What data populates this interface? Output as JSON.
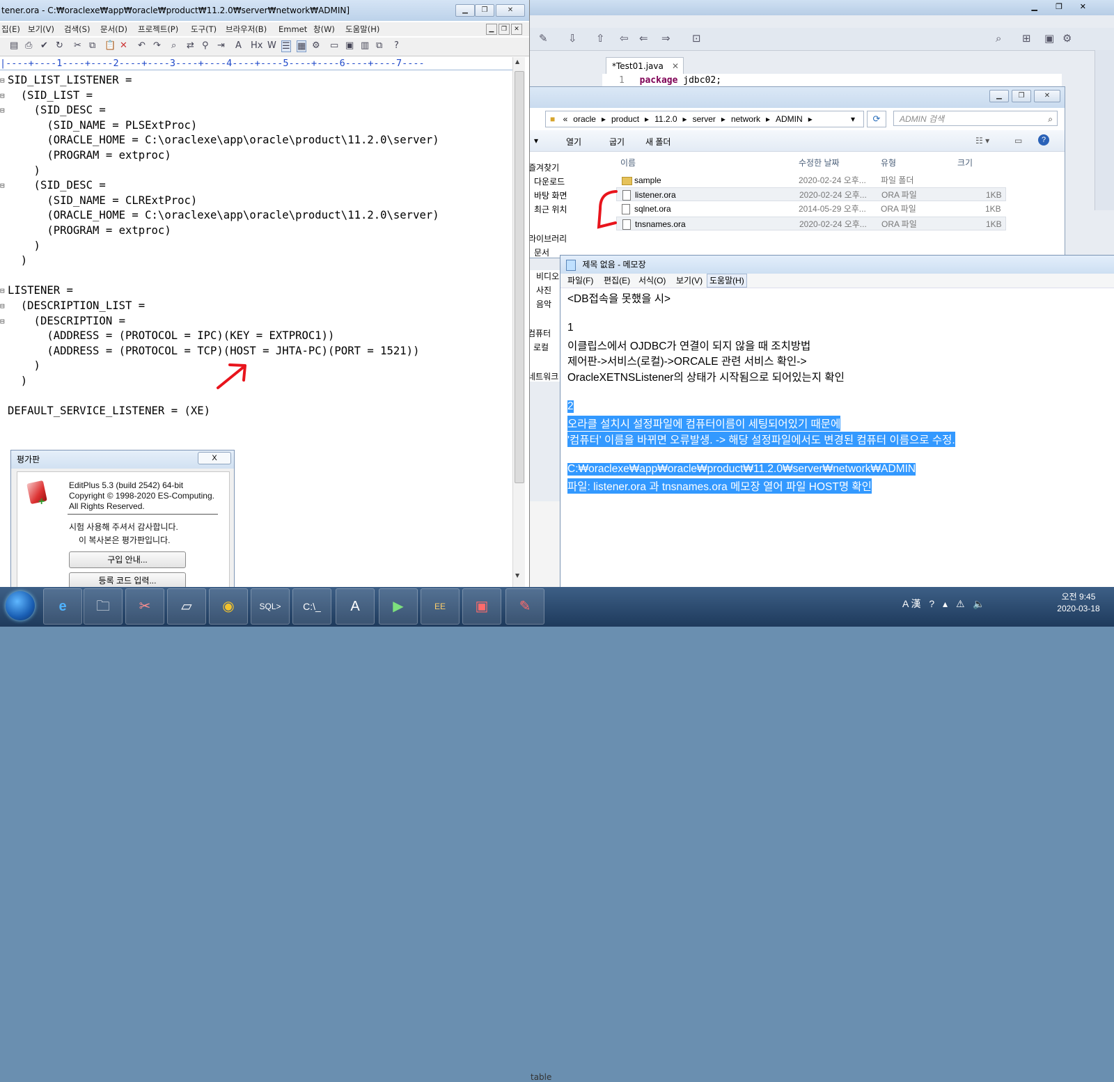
{
  "editplus": {
    "title": "tener.ora - C:₩oraclexe₩app₩oracle₩product₩11.2.0₩server₩network₩ADMIN]",
    "menu": [
      "집(E)",
      "보기(V)",
      "검색(S)",
      "문서(D)",
      "프로젝트(P)",
      "도구(T)",
      "브라우저(B)",
      "Emmet",
      "창(W)",
      "도움말(H)"
    ],
    "ruler": "|----+----1----+----2----+----3----+----4----+----5----+----6----+----7----",
    "code_lines": [
      "SID_LIST_LISTENER =",
      "  (SID_LIST =",
      "    (SID_DESC =",
      "      (SID_NAME = PLSExtProc)",
      "      (ORACLE_HOME = C:\\oraclexe\\app\\oracle\\product\\11.2.0\\server)",
      "      (PROGRAM = extproc)",
      "    )",
      "    (SID_DESC =",
      "      (SID_NAME = CLRExtProc)",
      "      (ORACLE_HOME = C:\\oraclexe\\app\\oracle\\product\\11.2.0\\server)",
      "      (PROGRAM = extproc)",
      "    )",
      "  )",
      "",
      "LISTENER =",
      "  (DESCRIPTION_LIST =",
      "    (DESCRIPTION =",
      "      (ADDRESS = (PROTOCOL = IPC)(KEY = EXTPROC1))",
      "      (ADDRESS = (PROTOCOL = TCP)(HOST = JHTA-PC)(PORT = 1521))",
      "    )",
      "  )",
      "",
      "DEFAULT_SERVICE_LISTENER = (XE)"
    ]
  },
  "eval_dialog": {
    "title": "평가판",
    "close": "X",
    "product": "EditPlus 5.3 (build 2542) 64-bit",
    "copyright": "Copyright © 1998-2020 ES-Computing.",
    "rights": "All Rights Reserved.",
    "thanks": "시험 사용해 주셔서 감사합니다.",
    "notice": "이 복사본은 평가판입니다.",
    "buy_button": "구입 안내...",
    "register_button": "등록 코드 입력..."
  },
  "eclipse": {
    "tab_label": "*Test01.java",
    "code_line_no": "1",
    "code_keyword": "package",
    "code_rest": "jdbc02;",
    "lower_label": "table"
  },
  "explorer": {
    "breadcrumb": [
      "«",
      "oracle",
      "▸",
      "product",
      "▸",
      "11.2.0",
      "▸",
      "server",
      "▸",
      "network",
      "▸",
      "ADMIN",
      "▸"
    ],
    "search_placeholder": "ADMIN 검색",
    "commands": [
      "열기",
      "굽기",
      "새 폴더"
    ],
    "nav": [
      "즐겨찾기",
      "다운로드",
      "바탕 화면",
      "최근 위치",
      "라이브러리",
      "문서",
      "비디오",
      "사진",
      "음악",
      "컴퓨터",
      "로컬",
      "네트워크"
    ],
    "headers": [
      "이름",
      "수정한 날짜",
      "유형",
      "크기"
    ],
    "files": [
      {
        "name": "sample",
        "date": "2020-02-24 오후...",
        "type": "파일 폴더",
        "size": "",
        "folder": true
      },
      {
        "name": "listener.ora",
        "date": "2020-02-24 오후...",
        "type": "ORA 파일",
        "size": "1KB",
        "folder": false
      },
      {
        "name": "sqlnet.ora",
        "date": "2014-05-29 오후...",
        "type": "ORA 파일",
        "size": "1KB",
        "folder": false
      },
      {
        "name": "tnsnames.ora",
        "date": "2020-02-24 오후...",
        "type": "ORA 파일",
        "size": "1KB",
        "folder": false
      }
    ]
  },
  "notepad": {
    "title": "제목 없음 - 메모장",
    "menu": [
      "파일(F)",
      "편집(E)",
      "서식(O)",
      "보기(V)",
      "도움말(H)"
    ],
    "lines": [
      "<DB접속을 못했을 시>",
      "",
      "1",
      "이클립스에서 OJDBC가 연결이 되지 않을 때 조치방법",
      "제어판->서비스(로컬)->ORCALE 관련 서비스 확인->",
      "OracleXETNSListener의 상태가 시작됨으로 되어있는지 확인",
      "",
      "2",
      "오라클 설치시 설정파일에 컴퓨터이름이 세팅되어있기 때문에",
      "'컴퓨터' 이름을 바뀌면 오류발생. -> 해당 설정파일에서도 변경된 컴퓨터 이름으로 수정.",
      "",
      "C:₩oraclexe₩app₩oracle₩product₩11.2.0₩server₩network₩ADMIN",
      "파일: listener.ora 과 tnsnames.ora 메모장 열어 파일 HOST명 확인"
    ]
  },
  "taskbar": {
    "time": "오전 9:45",
    "date": "2020-03-18",
    "tray": "A 漢"
  },
  "colors": {
    "selection": "#3399ff",
    "ruler": "#1f49c9",
    "annotation": "#e8141c"
  }
}
